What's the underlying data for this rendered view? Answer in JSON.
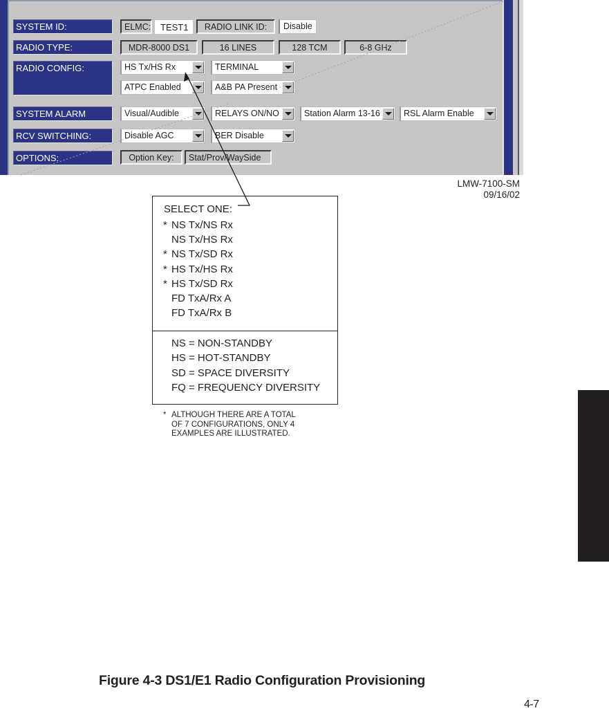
{
  "screen": {
    "rows": {
      "system_id": {
        "label": "SYSTEM ID:",
        "elmc_label": "ELMC:",
        "elmc_value": "TEST1",
        "radio_link_id_label": "RADIO LINK ID:",
        "radio_link_id_value": "Disable"
      },
      "radio_type": {
        "label": "RADIO TYPE:",
        "values": [
          "MDR-8000 DS1",
          "16 LINES",
          "128 TCM",
          "6-8 GHz"
        ]
      },
      "radio_config": {
        "label": "RADIO CONFIG:",
        "dropdowns": [
          "HS Tx/HS Rx",
          "TERMINAL",
          "ATPC Enabled",
          "A&B PA Present"
        ]
      },
      "system_alarm": {
        "label": "SYSTEM ALARM",
        "dropdowns": [
          "Visual/Audible",
          "RELAYS ON/NO",
          "Station Alarm 13-16",
          "RSL Alarm Enable"
        ]
      },
      "rcv_switching": {
        "label": "RCV SWITCHING:",
        "dropdowns": [
          "Disable AGC",
          "BER Disable"
        ]
      },
      "options": {
        "label": "OPTIONS:",
        "option_key_label": "Option Key:",
        "option_key_value": "Stat/Prov/WaySide"
      }
    }
  },
  "doc_ref": {
    "code": "LMW-7100-SM",
    "date": "09/16/02"
  },
  "callout": {
    "title": "SELECT ONE:",
    "options": [
      {
        "marker": "*",
        "text": "NS Tx/NS Rx"
      },
      {
        "marker": "",
        "text": "NS Tx/HS Rx"
      },
      {
        "marker": "*",
        "text": "NS Tx/SD Rx"
      },
      {
        "marker": "*",
        "text": "HS Tx/HS Rx"
      },
      {
        "marker": "*",
        "text": "HS Tx/SD Rx"
      },
      {
        "marker": "",
        "text": "FD TxA/Rx A"
      },
      {
        "marker": "",
        "text": "FD TxA/Rx B"
      }
    ],
    "legend": [
      "NS = NON-STANDBY",
      "HS = HOT-STANDBY",
      "SD = SPACE DIVERSITY",
      "FQ = FREQUENCY DIVERSITY"
    ]
  },
  "footnote": {
    "marker": "*",
    "lines": [
      "ALTHOUGH THERE ARE A TOTAL",
      "OF 7 CONFIGURATIONS, ONLY 4",
      "EXAMPLES ARE ILLUSTRATED."
    ]
  },
  "figure_caption": "Figure 4-3  DS1/E1 Radio Configuration Provisioning",
  "page_number": "4-7"
}
